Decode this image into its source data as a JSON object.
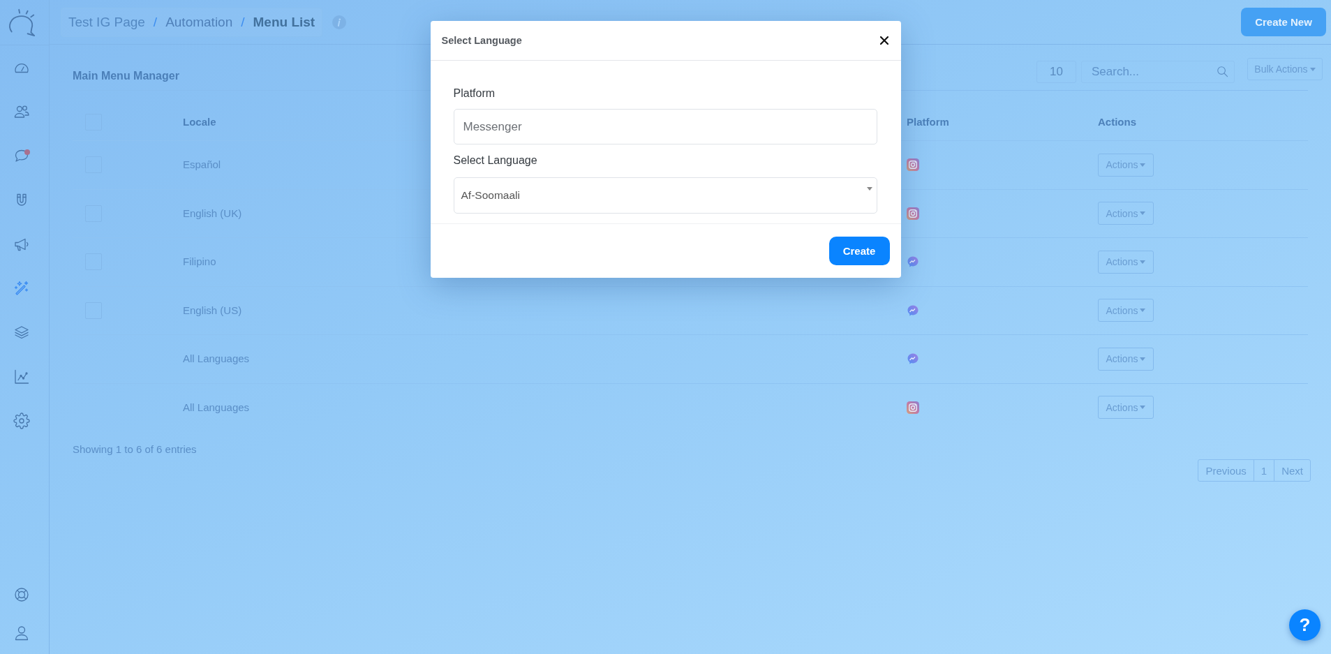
{
  "sidebar": {
    "items": [
      {
        "selected": false,
        "notification": false
      },
      {
        "selected": false,
        "notification": false
      },
      {
        "selected": false,
        "notification": true
      },
      {
        "selected": false,
        "notification": false
      },
      {
        "selected": false,
        "notification": false
      },
      {
        "selected": true,
        "notification": false
      },
      {
        "selected": false,
        "notification": false
      },
      {
        "selected": false,
        "notification": false
      },
      {
        "selected": false,
        "notification": false
      }
    ]
  },
  "breadcrumb": {
    "items": [
      {
        "label": "Test IG Page",
        "current": false
      },
      {
        "label": "Automation",
        "current": false
      },
      {
        "label": "Menu List",
        "current": true
      }
    ],
    "separators": [
      "/",
      "/"
    ]
  },
  "header_button": "Create New",
  "panel": {
    "title": "Main Menu Manager",
    "page_length": "10",
    "search": {
      "placeholder": "Search..."
    },
    "bulk_button": "Bulk Actions"
  },
  "table": {
    "select_all": {
      "checked": false
    },
    "columns": [
      "Locale",
      "Platform",
      "Actions"
    ],
    "rows": [
      {
        "checked": false,
        "locale": "Español",
        "kind": "instagram",
        "action": "Actions"
      },
      {
        "checked": false,
        "locale": "English (UK)",
        "kind": "instagram",
        "action": "Actions"
      },
      {
        "checked": false,
        "locale": "Filipino",
        "kind": "messenger",
        "action": "Actions"
      },
      {
        "checked": false,
        "locale": "English (US)",
        "kind": "messenger",
        "action": "Actions"
      },
      {
        "locale": "All Languages",
        "kind": "messenger",
        "action": "Actions"
      },
      {
        "locale": "All Languages",
        "kind": "instagram",
        "action": "Actions"
      }
    ]
  },
  "info": "Showing 1 to 6 of 6 entries",
  "pagination": [
    "Previous",
    "1",
    "Next"
  ],
  "modal": {
    "title": "Select Language",
    "fields": [
      {
        "kind": "input",
        "label": "Platform",
        "value": "Messenger"
      },
      {
        "kind": "select",
        "label": "Select Language",
        "value": "Af-Soomaali"
      }
    ],
    "button": "Create"
  },
  "help_button": "?"
}
